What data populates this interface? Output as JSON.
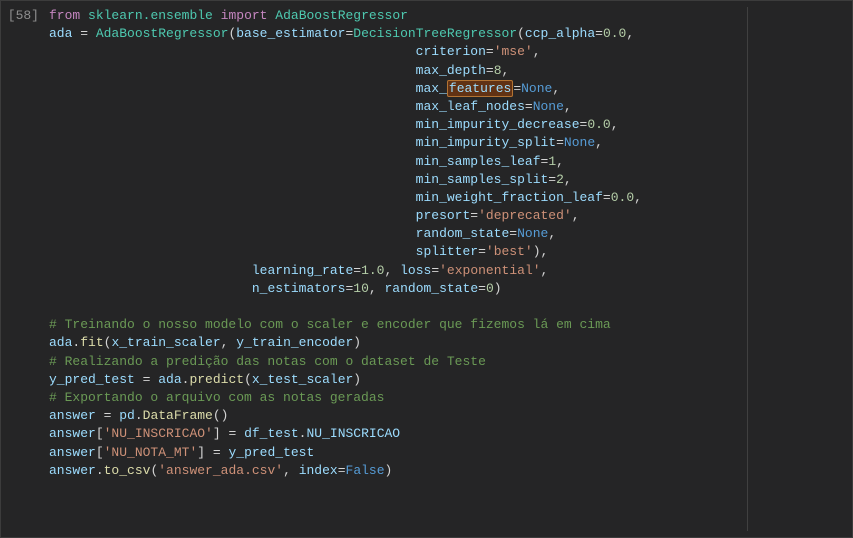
{
  "cell_prompt": "[58]",
  "l1": {
    "kw_from": "from",
    "mod": "sklearn.ensemble",
    "kw_import": "import",
    "cls": "AdaBoostRegressor"
  },
  "l2": {
    "var": "ada",
    "eq": " = ",
    "cls": "AdaBoostRegressor",
    "p_base": "base_estimator",
    "base_cls": "DecisionTreeRegressor",
    "p_ccp": "ccp_alpha",
    "v_ccp": "0.0"
  },
  "l3": {
    "p": "criterion",
    "v": "'mse'"
  },
  "l4": {
    "p": "max_depth",
    "v": "8"
  },
  "l5": {
    "p_pre": "max_",
    "p_hl": "features",
    "v": "None"
  },
  "l6": {
    "p": "max_leaf_nodes",
    "v": "None"
  },
  "l7": {
    "p": "min_impurity_decrease",
    "v": "0.0"
  },
  "l8": {
    "p": "min_impurity_split",
    "v": "None"
  },
  "l9": {
    "p": "min_samples_leaf",
    "v": "1"
  },
  "l10": {
    "p": "min_samples_split",
    "v": "2"
  },
  "l11": {
    "p": "min_weight_fraction_leaf",
    "v": "0.0"
  },
  "l12": {
    "p": "presort",
    "v": "'deprecated'"
  },
  "l13": {
    "p": "random_state",
    "v": "None"
  },
  "l14": {
    "p": "splitter",
    "v": "'best'"
  },
  "l15": {
    "p_lr": "learning_rate",
    "v_lr": "1.0",
    "p_loss": "loss",
    "v_loss": "'exponential'"
  },
  "l16": {
    "p_ne": "n_estimators",
    "v_ne": "10",
    "p_rs": "random_state",
    "v_rs": "0"
  },
  "c1": "# Treinando o nosso modelo com o scaler e encoder que fizemos lá em cima",
  "l18": {
    "obj": "ada",
    "fn": "fit",
    "a1": "x_train_scaler",
    "a2": "y_train_encoder"
  },
  "c2": "# Realizando a predição das notas com o dataset de Teste",
  "l20": {
    "var": "y_pred_test",
    "obj": "ada",
    "fn": "predict",
    "a1": "x_test_scaler"
  },
  "c3": "# Exportando o arquivo com as notas geradas",
  "l22": {
    "var": "answer",
    "mod": "pd",
    "fn": "DataFrame"
  },
  "l23": {
    "var": "answer",
    "key": "'NU_INSCRICAO'",
    "rhs_obj": "df_test",
    "rhs_attr": "NU_INSCRICAO"
  },
  "l24": {
    "var": "answer",
    "key": "'NU_NOTA_MT'",
    "rhs": "y_pred_test"
  },
  "l25": {
    "var": "answer",
    "fn": "to_csv",
    "file": "'answer_ada.csv'",
    "p_idx": "index",
    "v_idx": "False"
  },
  "indent": {
    "params": "                                               ",
    "inner": "                          "
  }
}
